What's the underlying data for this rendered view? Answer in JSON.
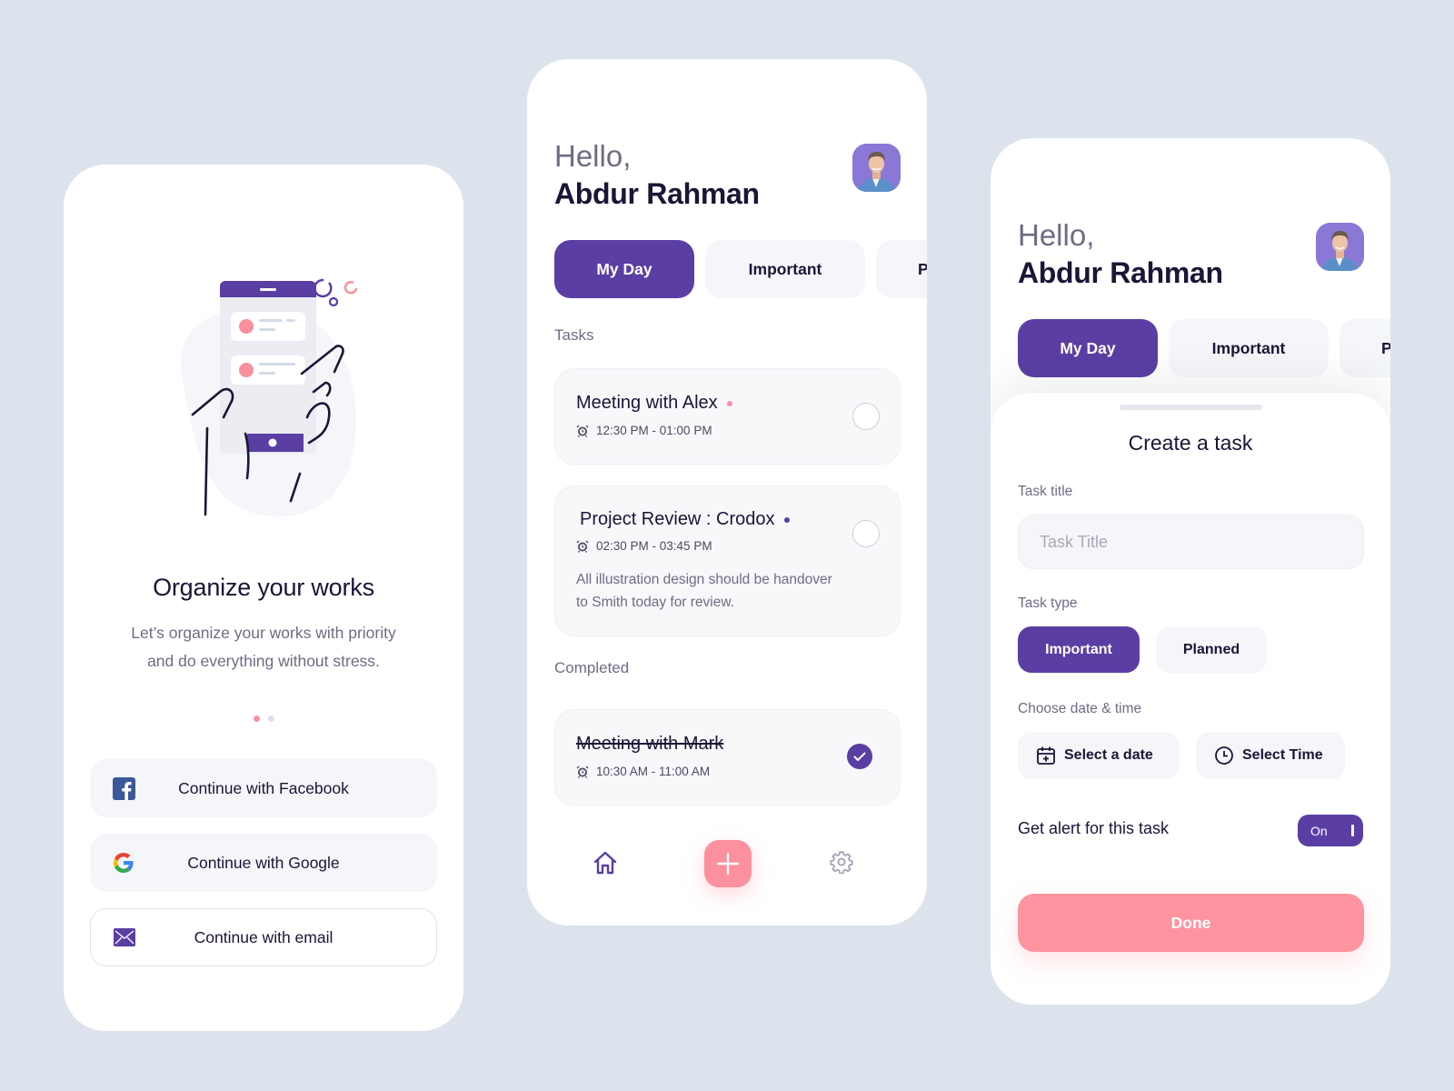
{
  "onboarding": {
    "title": "Organize your works",
    "subtitle_line1": "Let’s organize your works with priority",
    "subtitle_line2": "and do everything without stress.",
    "pagination": {
      "total": 2,
      "active": 1
    },
    "buttons": [
      {
        "label": "Continue with Facebook",
        "icon": "facebook-icon"
      },
      {
        "label": "Continue with Google",
        "icon": "google-icon"
      },
      {
        "label": "Continue with email",
        "icon": "email-icon"
      }
    ]
  },
  "home": {
    "greeting": "Hello,",
    "user_name": "Abdur Rahman",
    "tabs": [
      {
        "label": "My Day",
        "active": true
      },
      {
        "label": "Important",
        "active": false
      },
      {
        "label": "P",
        "active": false
      }
    ],
    "tasks_label": "Tasks",
    "tasks": [
      {
        "title": "Meeting with Alex",
        "time": "12:30 PM - 01:00 PM",
        "priority_color": "#fb8f9d",
        "done": false
      },
      {
        "title": "Project Review : Crodox",
        "time": "02:30 PM - 03:45 PM",
        "priority_color": "#5a3ea3",
        "description_line1": "All illustration design should be handover",
        "description_line2": "to Smith today for review.",
        "done": false
      }
    ],
    "completed_label": "Completed",
    "completed": [
      {
        "title": "Meeting with Mark",
        "time": "10:30 AM - 11:00 AM",
        "done": true
      }
    ],
    "nav": [
      "home-icon",
      "add-icon",
      "settings-icon"
    ]
  },
  "create_task": {
    "greeting": "Hello,",
    "user_name": "Abdur Rahman",
    "tabs": [
      {
        "label": "My Day",
        "active": true
      },
      {
        "label": "Important",
        "active": false
      },
      {
        "label": "P",
        "active": false
      }
    ],
    "sheet_title": "Create a task",
    "task_title_label": "Task title",
    "task_title_placeholder": "Task Title",
    "task_title_value": "",
    "task_type_label": "Task type",
    "task_types": [
      {
        "label": "Important",
        "selected": true
      },
      {
        "label": "Planned",
        "selected": false
      }
    ],
    "datetime_label": "Choose date & time",
    "select_date_label": "Select a date",
    "select_time_label": "Select Time",
    "alert_label": "Get alert for this task",
    "alert_toggle": {
      "label": "On",
      "on": true
    },
    "done_label": "Done"
  },
  "colors": {
    "primary": "#5a3ea3",
    "accent": "#fd909e",
    "background": "#dde3ec",
    "text": "#1b1536",
    "muted": "#6f6c82"
  }
}
